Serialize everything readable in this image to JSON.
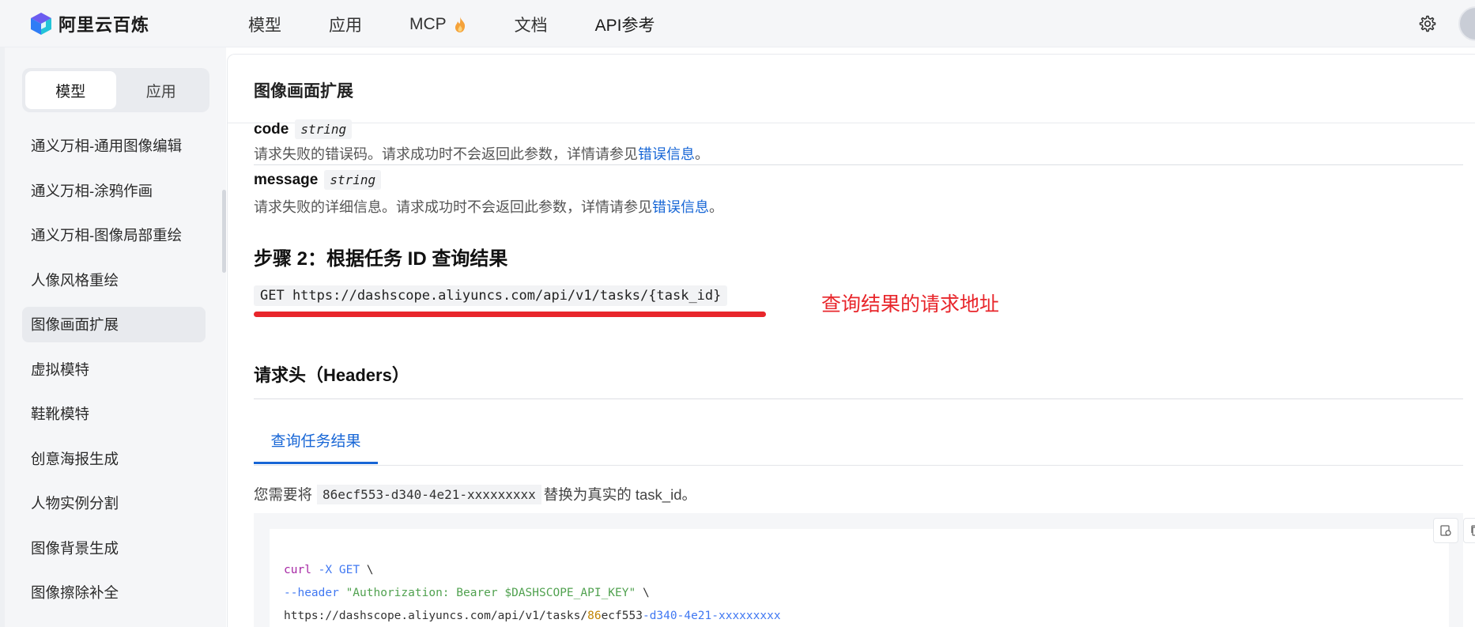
{
  "brand": {
    "name": "阿里云百炼"
  },
  "nav": {
    "items": [
      "模型",
      "应用",
      "MCP",
      "文档",
      "API参考"
    ]
  },
  "sidebar": {
    "segments": [
      "模型",
      "应用"
    ],
    "active_segment": 0,
    "items": [
      "通义万相-通用图像编辑",
      "通义万相-涂鸦作画",
      "通义万相-图像局部重绘",
      "人像风格重绘",
      "图像画面扩展",
      "虚拟模特",
      "鞋靴模特",
      "创意海报生成",
      "人物实例分割",
      "图像背景生成",
      "图像擦除补全"
    ],
    "active_item": 4
  },
  "page": {
    "title": "图像画面扩展",
    "params": [
      {
        "name": "code",
        "type": "string",
        "desc": "请求失败的错误码。请求成功时不会返回此参数，详情请参见",
        "link": "错误信息",
        "end": "。"
      },
      {
        "name": "message",
        "type": "string",
        "desc": "请求失败的详细信息。请求成功时不会返回此参数，详情请参见",
        "link": "错误信息",
        "end": "。"
      }
    ],
    "step_heading": "步骤 2：根据任务 ID 查询结果",
    "endpoint": "GET https://dashscope.aliyuncs.com/api/v1/tasks/{task_id}",
    "annotation": "查询结果的请求地址",
    "headers_heading": "请求头（Headers）",
    "tab": "查询任务结果",
    "note_prefix": "您需要将",
    "note_code": "86ecf553-d340-4e21-xxxxxxxxx",
    "note_suffix": "替换为真实的 task_id。"
  },
  "code": {
    "l1_cmd": "curl",
    "l1_flag": "-X",
    "l1_method": "GET",
    "l1_tail": " \\",
    "l2_flag": "--header",
    "l2_str": "\"Authorization: Bearer $DASHSCOPE_API_KEY\"",
    "l2_tail": " \\",
    "l3_url": "https://dashscope.aliyuncs.com/api/v1/tasks/",
    "l3_num": "86",
    "l3_mid": "ecf553",
    "l3_rest": "-d340-4e21-xxxxxxxxx"
  },
  "colors": {
    "accent": "#1766d6",
    "annotation": "#e8262b"
  },
  "icons": {
    "settings": "gear-icon",
    "mcp": "fire-icon"
  }
}
